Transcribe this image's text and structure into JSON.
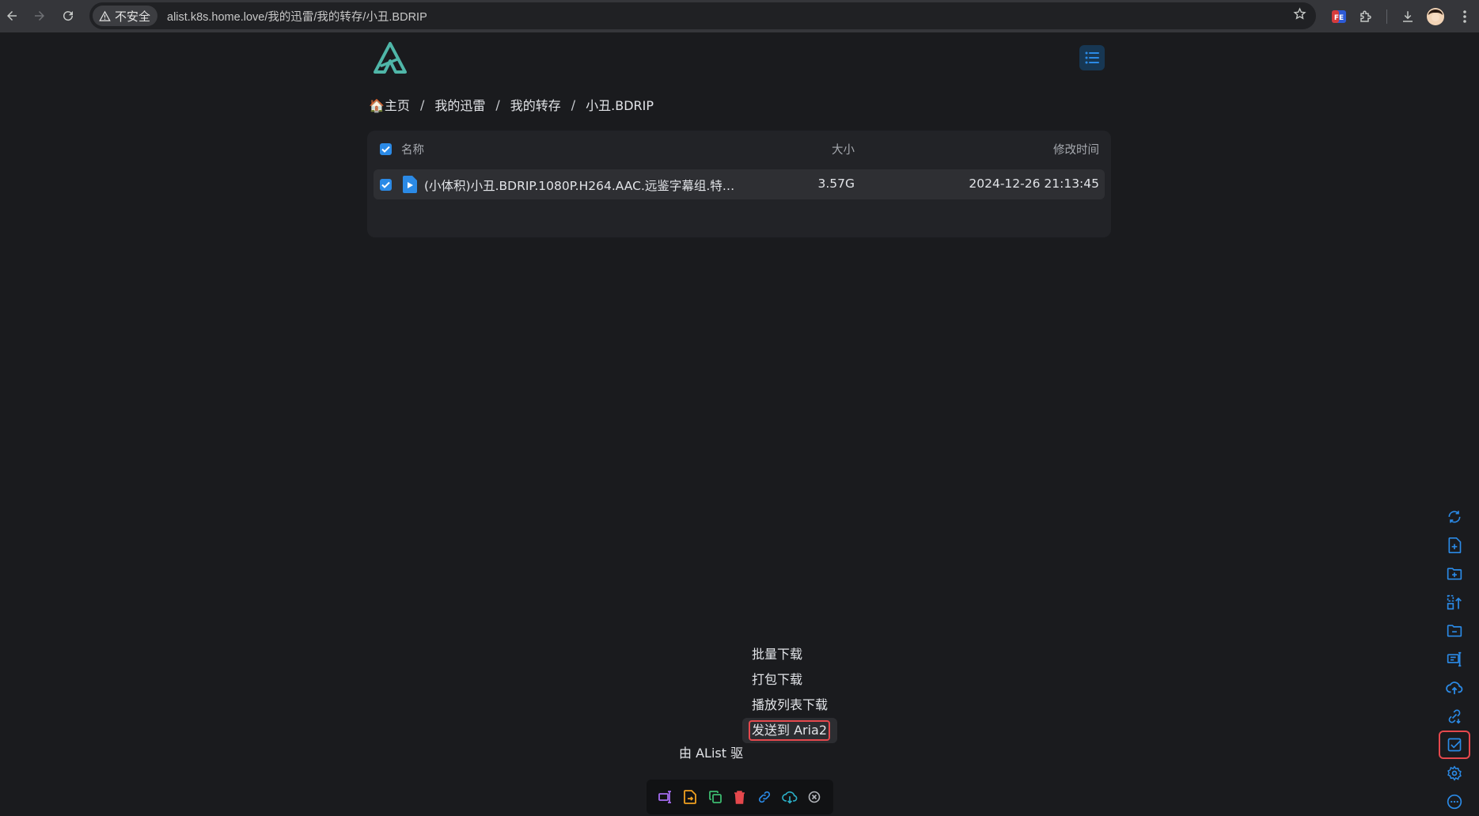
{
  "browser": {
    "security_label": "不安全",
    "url": "alist.k8s.home.love/我的迅雷/我的转存/小丑.BDRIP"
  },
  "breadcrumb": {
    "home": "🏠主页",
    "items": [
      "我的迅雷",
      "我的转存",
      "小丑.BDRIP"
    ],
    "separator": "/"
  },
  "table": {
    "headers": {
      "name": "名称",
      "size": "大小",
      "modified": "修改时间"
    },
    "rows": [
      {
        "name": "(小体积)小丑.BDRIP.1080P.H264.AAC.远鉴字幕组.特…",
        "size": "3.57G",
        "modified": "2024-12-26 21:13:45",
        "icon": "video-file-icon"
      }
    ]
  },
  "menu": {
    "items": [
      "批量下载",
      "打包下载",
      "播放列表下载",
      "发送到 Aria2"
    ]
  },
  "footer": {
    "text": "由 AList 驱"
  },
  "colors": {
    "accent": "#2b8ae6",
    "highlight": "#e5484d",
    "logo": "#4fb6a8"
  }
}
